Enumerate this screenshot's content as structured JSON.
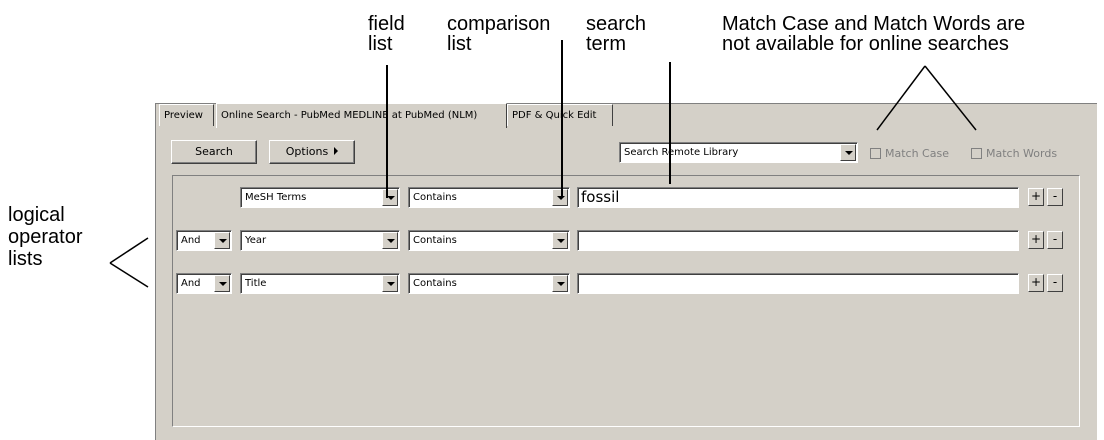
{
  "annotations": {
    "field_list": [
      "field",
      "list"
    ],
    "comparison_list": [
      "comparison",
      "list"
    ],
    "search_term": [
      "search",
      "term"
    ],
    "match_note": [
      "Match Case and Match Words are",
      "not available for online searches"
    ],
    "logical_ops": [
      "logical",
      "operator",
      "lists"
    ]
  },
  "tabs": [
    {
      "label": "Preview"
    },
    {
      "label": "Online Search - PubMed MEDLINE at PubMed (NLM)"
    },
    {
      "label": "PDF & Quick Edit"
    }
  ],
  "toolbar": {
    "search_label": "Search",
    "options_label": "Options",
    "library_select": "Search Remote Library",
    "match_case_label": "Match Case",
    "match_words_label": "Match Words"
  },
  "rows": [
    {
      "logic": "",
      "field": "MeSH Terms",
      "comparison": "Contains",
      "term": "fossil"
    },
    {
      "logic": "And",
      "field": "Year",
      "comparison": "Contains",
      "term": ""
    },
    {
      "logic": "And",
      "field": "Title",
      "comparison": "Contains",
      "term": ""
    }
  ],
  "row_buttons": {
    "add": "+",
    "remove": "-"
  },
  "colors": {
    "panel": "#d4d0c8",
    "field": "#ffffff",
    "disabled_text": "#808080"
  }
}
